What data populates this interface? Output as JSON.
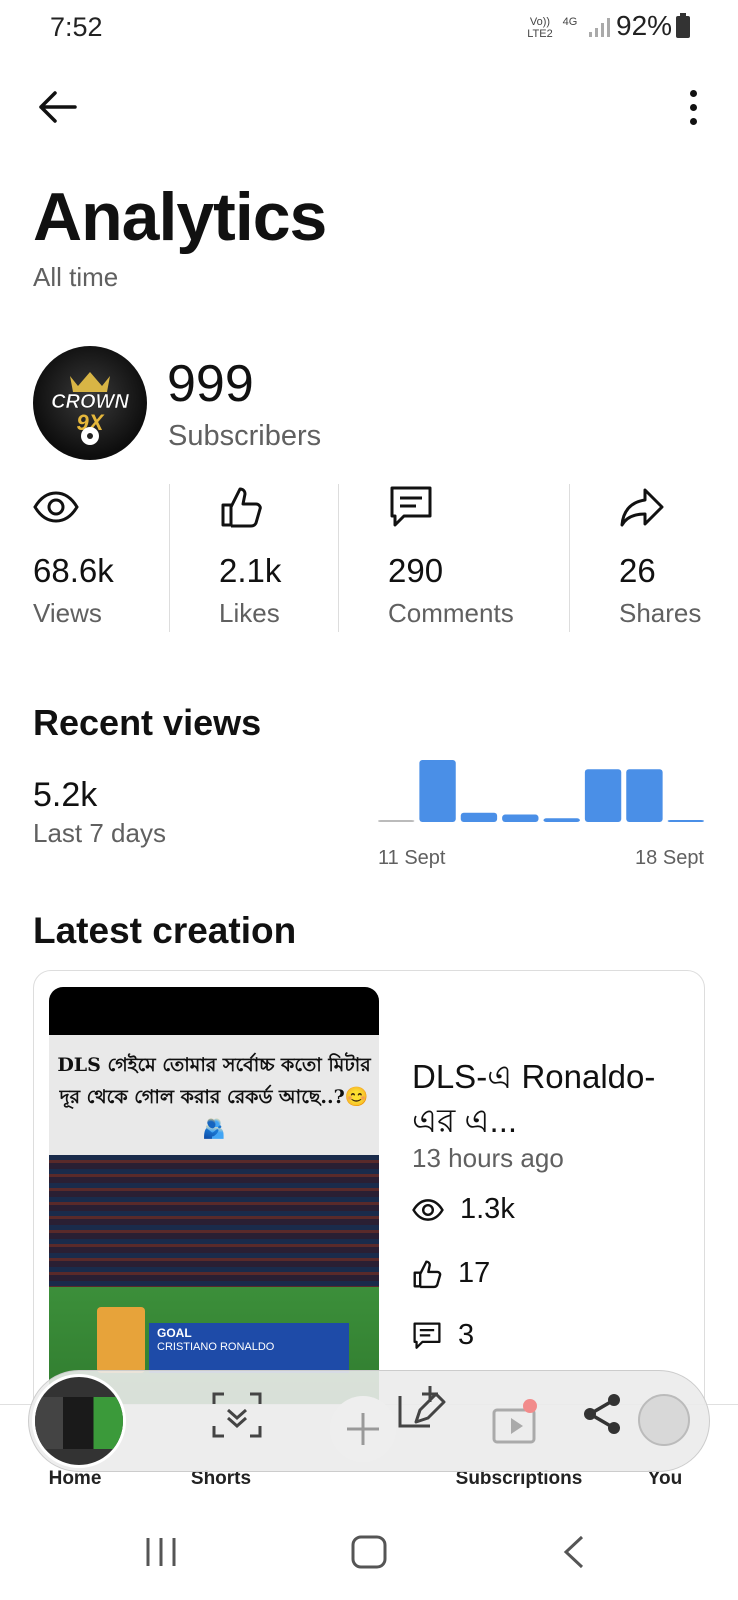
{
  "status_bar": {
    "time": "7:52",
    "network_a": "Vo)) LTE2",
    "network_b": "4G",
    "battery": "92%"
  },
  "header": {
    "title": "Analytics",
    "subtitle": "All time"
  },
  "channel": {
    "avatar_text": "CROWN 9X",
    "subscribers": "999",
    "subscribers_label": "Subscribers"
  },
  "stats": [
    {
      "icon": "eye-icon",
      "value": "68.6k",
      "label": "Views"
    },
    {
      "icon": "thumbs-up-icon",
      "value": "2.1k",
      "label": "Likes"
    },
    {
      "icon": "comment-icon",
      "value": "290",
      "label": "Comments"
    },
    {
      "icon": "share-icon",
      "value": "26",
      "label": "Shares"
    }
  ],
  "recent_views": {
    "title": "Recent views",
    "value": "5.2k",
    "period": "Last 7 days"
  },
  "chart_data": {
    "type": "bar",
    "x_start_label": "11 Sept",
    "x_end_label": "18 Sept",
    "values": [
      0.03,
      1.0,
      0.15,
      0.12,
      0.06,
      0.85,
      0.85,
      0.03
    ],
    "color": "#4a8fe7"
  },
  "latest": {
    "title": "Latest creation",
    "thumb_caption": "DLS গেইমে তোমার সর্বোচ্চ কতো মিটার দূর থেকে গোল করার রেকর্ড আছে..?😊🫂",
    "thumb_goal": "GOAL",
    "thumb_player": "CRISTIANO RONALDO",
    "video_title": "DLS-এ Ronaldo-এর এ...",
    "age": "13 hours ago",
    "views": "1.3k",
    "likes": "17",
    "comments": "3"
  },
  "nav": {
    "home": "Home",
    "shorts": "Shorts",
    "subscriptions": "Subscriptions",
    "you": "You"
  }
}
